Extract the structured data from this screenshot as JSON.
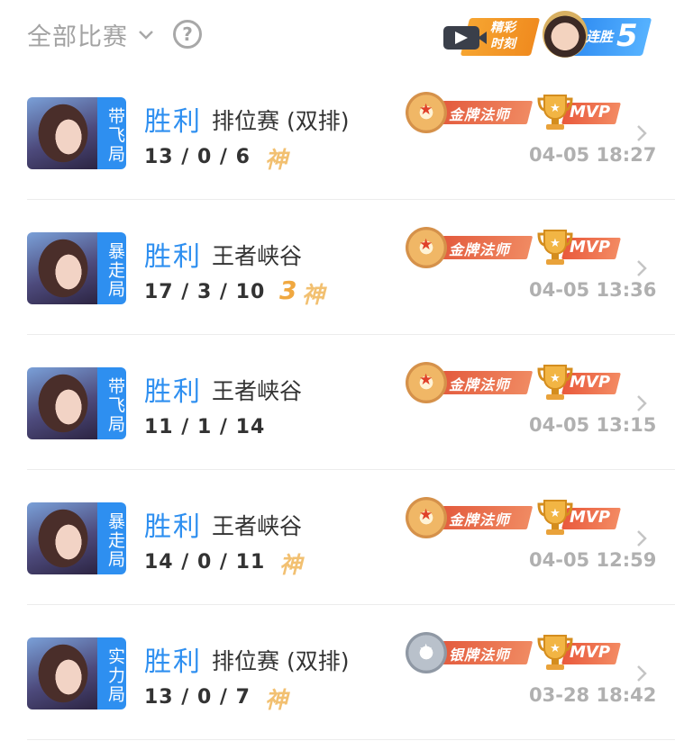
{
  "header": {
    "filter_label": "全部比赛",
    "help_label": "?",
    "highlight_label_line1": "精彩",
    "highlight_label_line2": "时刻",
    "streak_label": "连胜",
    "streak_count": "5"
  },
  "matches": [
    {
      "tag": "带飞局",
      "result": "胜利",
      "mode": "排位赛 (双排)",
      "kda": "13 / 0 / 6",
      "multikill": "",
      "god": "神",
      "medal": "金牌法师",
      "medal_tier": "gold",
      "mvp": "MVP",
      "time": "04-05 18:27"
    },
    {
      "tag": "暴走局",
      "result": "胜利",
      "mode": "王者峡谷",
      "kda": "17 / 3 / 10",
      "multikill": "3",
      "god": "神",
      "medal": "金牌法师",
      "medal_tier": "gold",
      "mvp": "MVP",
      "time": "04-05 13:36"
    },
    {
      "tag": "带飞局",
      "result": "胜利",
      "mode": "王者峡谷",
      "kda": "11 / 1 / 14",
      "multikill": "",
      "god": "",
      "medal": "金牌法师",
      "medal_tier": "gold",
      "mvp": "MVP",
      "time": "04-05 13:15"
    },
    {
      "tag": "暴走局",
      "result": "胜利",
      "mode": "王者峡谷",
      "kda": "14 / 0 / 11",
      "multikill": "",
      "god": "神",
      "medal": "金牌法师",
      "medal_tier": "gold",
      "mvp": "MVP",
      "time": "04-05 12:59"
    },
    {
      "tag": "实力局",
      "result": "胜利",
      "mode": "排位赛 (双排)",
      "kda": "13 / 0 / 7",
      "multikill": "",
      "god": "神",
      "medal": "银牌法师",
      "medal_tier": "silver",
      "mvp": "MVP",
      "time": "03-28 18:42"
    }
  ],
  "colors": {
    "accent": "#2e8ff0",
    "medal_ribbon": "#e35a3d",
    "muted": "#a3a3a3"
  },
  "icons": {
    "filter": "chevron-down-icon",
    "help": "question-circle-icon",
    "highlight": "video-camera-icon",
    "row_arrow": "chevron-right-icon",
    "mvp": "trophy-icon",
    "medal": "medal-icon"
  }
}
